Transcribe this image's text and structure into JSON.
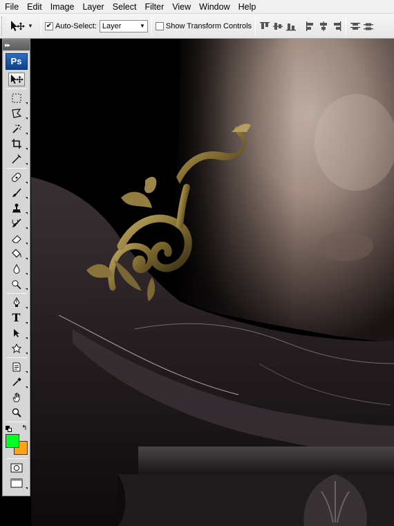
{
  "menubar": {
    "items": [
      "File",
      "Edit",
      "Image",
      "Layer",
      "Select",
      "Filter",
      "View",
      "Window",
      "Help"
    ]
  },
  "options": {
    "auto_select_label": "Auto-Select:",
    "auto_select_checked": true,
    "auto_select_value": "Layer",
    "show_transform_label": "Show Transform Controls",
    "show_transform_checked": false
  },
  "toolbox": {
    "collapse_glyph": "▸▸",
    "logo": "Ps",
    "tools": [
      "move-tool",
      "marquee-tool",
      "lasso-tool",
      "magic-wand-tool",
      "crop-tool",
      "eyedropper-tool",
      "healing-brush-tool",
      "brush-tool",
      "clone-stamp-tool",
      "history-brush-tool",
      "eraser-tool",
      "paint-bucket-tool",
      "blur-tool",
      "dodge-tool",
      "pen-tool",
      "type-tool",
      "path-selection-tool",
      "custom-shape-tool",
      "notes-tool",
      "color-sampler-tool",
      "hand-tool",
      "zoom-tool"
    ],
    "type_glyph": "T",
    "swap_glyph": "↰",
    "foreground_color": "#00ff22",
    "background_color": "#ffa31a"
  },
  "colors": {
    "accent_blue": "#1a5bb0",
    "canvas_bg": "#000000",
    "ornament_gold": "#8a7a3c",
    "skin": "#a8978c",
    "fabric": "#2b2427"
  }
}
